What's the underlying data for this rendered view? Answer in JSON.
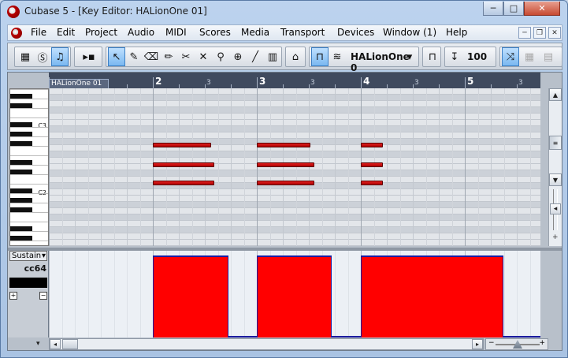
{
  "window": {
    "title": "Cubase 5 - [Key Editor: HALionOne 01]",
    "minimize": "─",
    "maximize": "□",
    "close": "✕"
  },
  "menu": {
    "items": [
      "File",
      "Edit",
      "Project",
      "Audio",
      "MIDI",
      "Scores",
      "Media",
      "Transport",
      "Devices",
      "Window (1)",
      "Help"
    ]
  },
  "toolbar": {
    "instrument": "HALionOne 0",
    "quantize": "100",
    "icons": [
      "solo-view-icon",
      "solo-icon",
      "feedback-icon",
      "autoscroll-icon",
      "select-icon",
      "draw-icon",
      "erase-icon",
      "pencil-icon",
      "split-icon",
      "mute-icon",
      "glue-icon",
      "zoom-icon",
      "line-icon",
      "time-warp-icon"
    ]
  },
  "ruler": {
    "part_name": "HALionOne 01",
    "bars": [
      "2",
      "3",
      "4",
      "5"
    ],
    "beats": [
      "3",
      "3",
      "3",
      "3"
    ]
  },
  "keyboard": {
    "labels": [
      "C3",
      "C2"
    ]
  },
  "controller": {
    "lane": "Sustain",
    "cc": "cc64"
  },
  "chart_data": {
    "type": "piano-roll",
    "notes": [
      {
        "bar_start": 2.0,
        "length_beats": 2.25,
        "row": 1
      },
      {
        "bar_start": 2.0,
        "length_beats": 2.35,
        "row": 2
      },
      {
        "bar_start": 2.0,
        "length_beats": 2.35,
        "row": 3
      },
      {
        "bar_start": 3.0,
        "length_beats": 2.05,
        "row": 1
      },
      {
        "bar_start": 3.0,
        "length_beats": 2.2,
        "row": 2
      },
      {
        "bar_start": 3.0,
        "length_beats": 2.2,
        "row": 3
      },
      {
        "bar_start": 4.0,
        "length_beats": 0.85,
        "row": 1
      },
      {
        "bar_start": 4.0,
        "length_beats": 0.85,
        "row": 2
      },
      {
        "bar_start": 4.0,
        "length_beats": 0.85,
        "row": 3
      }
    ],
    "sustain": [
      {
        "start_bar": 2.0,
        "end_bar": 2.73,
        "value": 127
      },
      {
        "start_bar": 3.0,
        "end_bar": 3.72,
        "value": 127
      },
      {
        "start_bar": 4.0,
        "end_bar": 5.37,
        "value": 127
      }
    ]
  }
}
